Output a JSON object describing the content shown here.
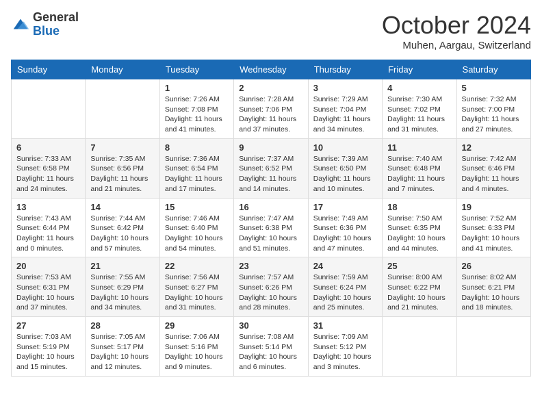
{
  "logo": {
    "general": "General",
    "blue": "Blue"
  },
  "title": "October 2024",
  "location": "Muhen, Aargau, Switzerland",
  "days_header": [
    "Sunday",
    "Monday",
    "Tuesday",
    "Wednesday",
    "Thursday",
    "Friday",
    "Saturday"
  ],
  "weeks": [
    [
      {
        "day": "",
        "info": ""
      },
      {
        "day": "",
        "info": ""
      },
      {
        "day": "1",
        "info": "Sunrise: 7:26 AM\nSunset: 7:08 PM\nDaylight: 11 hours and 41 minutes."
      },
      {
        "day": "2",
        "info": "Sunrise: 7:28 AM\nSunset: 7:06 PM\nDaylight: 11 hours and 37 minutes."
      },
      {
        "day": "3",
        "info": "Sunrise: 7:29 AM\nSunset: 7:04 PM\nDaylight: 11 hours and 34 minutes."
      },
      {
        "day": "4",
        "info": "Sunrise: 7:30 AM\nSunset: 7:02 PM\nDaylight: 11 hours and 31 minutes."
      },
      {
        "day": "5",
        "info": "Sunrise: 7:32 AM\nSunset: 7:00 PM\nDaylight: 11 hours and 27 minutes."
      }
    ],
    [
      {
        "day": "6",
        "info": "Sunrise: 7:33 AM\nSunset: 6:58 PM\nDaylight: 11 hours and 24 minutes."
      },
      {
        "day": "7",
        "info": "Sunrise: 7:35 AM\nSunset: 6:56 PM\nDaylight: 11 hours and 21 minutes."
      },
      {
        "day": "8",
        "info": "Sunrise: 7:36 AM\nSunset: 6:54 PM\nDaylight: 11 hours and 17 minutes."
      },
      {
        "day": "9",
        "info": "Sunrise: 7:37 AM\nSunset: 6:52 PM\nDaylight: 11 hours and 14 minutes."
      },
      {
        "day": "10",
        "info": "Sunrise: 7:39 AM\nSunset: 6:50 PM\nDaylight: 11 hours and 10 minutes."
      },
      {
        "day": "11",
        "info": "Sunrise: 7:40 AM\nSunset: 6:48 PM\nDaylight: 11 hours and 7 minutes."
      },
      {
        "day": "12",
        "info": "Sunrise: 7:42 AM\nSunset: 6:46 PM\nDaylight: 11 hours and 4 minutes."
      }
    ],
    [
      {
        "day": "13",
        "info": "Sunrise: 7:43 AM\nSunset: 6:44 PM\nDaylight: 11 hours and 0 minutes."
      },
      {
        "day": "14",
        "info": "Sunrise: 7:44 AM\nSunset: 6:42 PM\nDaylight: 10 hours and 57 minutes."
      },
      {
        "day": "15",
        "info": "Sunrise: 7:46 AM\nSunset: 6:40 PM\nDaylight: 10 hours and 54 minutes."
      },
      {
        "day": "16",
        "info": "Sunrise: 7:47 AM\nSunset: 6:38 PM\nDaylight: 10 hours and 51 minutes."
      },
      {
        "day": "17",
        "info": "Sunrise: 7:49 AM\nSunset: 6:36 PM\nDaylight: 10 hours and 47 minutes."
      },
      {
        "day": "18",
        "info": "Sunrise: 7:50 AM\nSunset: 6:35 PM\nDaylight: 10 hours and 44 minutes."
      },
      {
        "day": "19",
        "info": "Sunrise: 7:52 AM\nSunset: 6:33 PM\nDaylight: 10 hours and 41 minutes."
      }
    ],
    [
      {
        "day": "20",
        "info": "Sunrise: 7:53 AM\nSunset: 6:31 PM\nDaylight: 10 hours and 37 minutes."
      },
      {
        "day": "21",
        "info": "Sunrise: 7:55 AM\nSunset: 6:29 PM\nDaylight: 10 hours and 34 minutes."
      },
      {
        "day": "22",
        "info": "Sunrise: 7:56 AM\nSunset: 6:27 PM\nDaylight: 10 hours and 31 minutes."
      },
      {
        "day": "23",
        "info": "Sunrise: 7:57 AM\nSunset: 6:26 PM\nDaylight: 10 hours and 28 minutes."
      },
      {
        "day": "24",
        "info": "Sunrise: 7:59 AM\nSunset: 6:24 PM\nDaylight: 10 hours and 25 minutes."
      },
      {
        "day": "25",
        "info": "Sunrise: 8:00 AM\nSunset: 6:22 PM\nDaylight: 10 hours and 21 minutes."
      },
      {
        "day": "26",
        "info": "Sunrise: 8:02 AM\nSunset: 6:21 PM\nDaylight: 10 hours and 18 minutes."
      }
    ],
    [
      {
        "day": "27",
        "info": "Sunrise: 7:03 AM\nSunset: 5:19 PM\nDaylight: 10 hours and 15 minutes."
      },
      {
        "day": "28",
        "info": "Sunrise: 7:05 AM\nSunset: 5:17 PM\nDaylight: 10 hours and 12 minutes."
      },
      {
        "day": "29",
        "info": "Sunrise: 7:06 AM\nSunset: 5:16 PM\nDaylight: 10 hours and 9 minutes."
      },
      {
        "day": "30",
        "info": "Sunrise: 7:08 AM\nSunset: 5:14 PM\nDaylight: 10 hours and 6 minutes."
      },
      {
        "day": "31",
        "info": "Sunrise: 7:09 AM\nSunset: 5:12 PM\nDaylight: 10 hours and 3 minutes."
      },
      {
        "day": "",
        "info": ""
      },
      {
        "day": "",
        "info": ""
      }
    ]
  ]
}
